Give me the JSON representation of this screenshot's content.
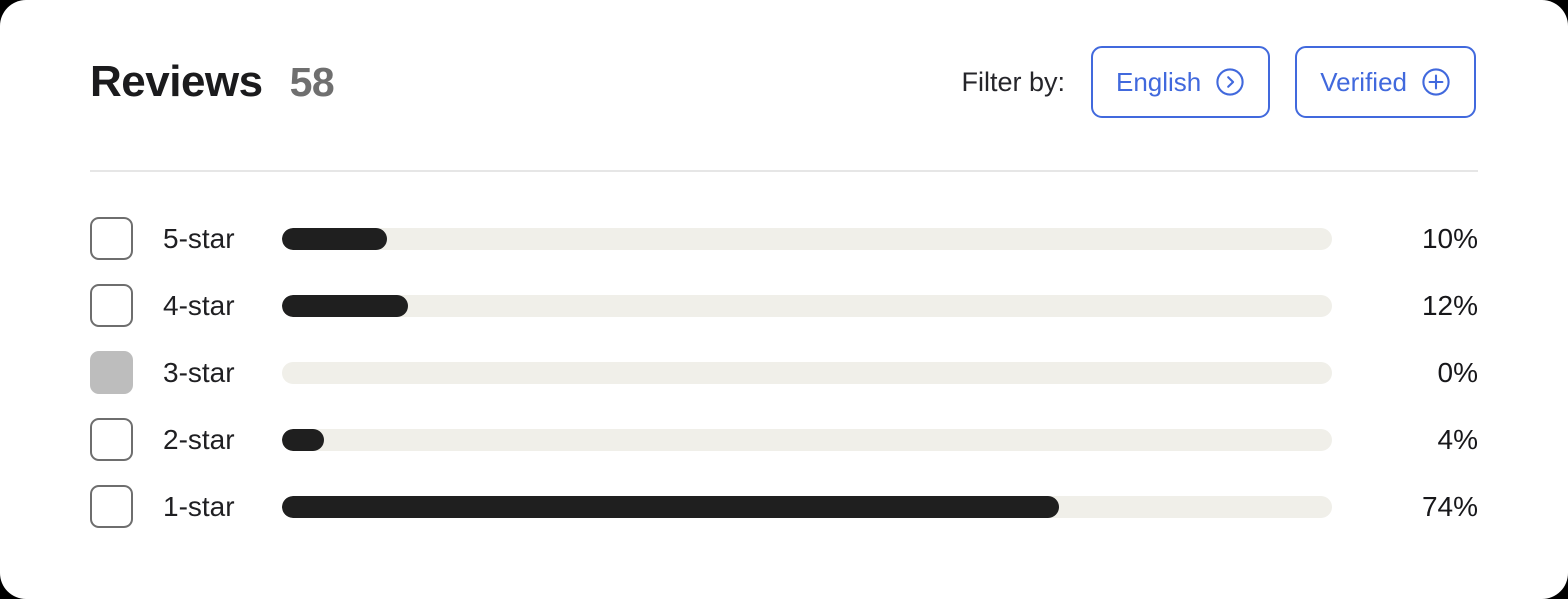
{
  "header": {
    "title": "Reviews",
    "count": "58",
    "filter_label": "Filter by:",
    "buttons": [
      {
        "label": "English",
        "icon": "chevron-right-circle-icon"
      },
      {
        "label": "Verified",
        "icon": "plus-circle-icon"
      }
    ]
  },
  "colors": {
    "accent_blue": "#4169dd",
    "bar_fill": "#1f1f1f",
    "bar_track": "#f0efe9",
    "checkbox_border": "#6e6e6e",
    "checkbox_disabled_fill": "#bdbdbd",
    "divider": "#e6e6e6",
    "title": "#1b1b1d",
    "count": "#6f6f6f"
  },
  "chart_data": {
    "type": "bar",
    "title": "Reviews 58",
    "xlabel": "",
    "ylabel": "",
    "xlim": [
      0,
      100
    ],
    "grid": false,
    "legend": "none",
    "orientation": "horizontal",
    "categories": [
      "5-star",
      "4-star",
      "3-star",
      "2-star",
      "1-star"
    ],
    "values": [
      10,
      12,
      0,
      4,
      74
    ],
    "value_labels": [
      "10%",
      "12%",
      "0%",
      "4%",
      "74%"
    ]
  },
  "rows": [
    {
      "label": "5-star",
      "percent_label": "10%",
      "value": 10,
      "checked": false,
      "disabled": false
    },
    {
      "label": "4-star",
      "percent_label": "12%",
      "value": 12,
      "checked": false,
      "disabled": false
    },
    {
      "label": "3-star",
      "percent_label": "0%",
      "value": 0,
      "checked": false,
      "disabled": true
    },
    {
      "label": "2-star",
      "percent_label": "4%",
      "value": 4,
      "checked": false,
      "disabled": false
    },
    {
      "label": "1-star",
      "percent_label": "74%",
      "value": 74,
      "checked": false,
      "disabled": false
    }
  ]
}
